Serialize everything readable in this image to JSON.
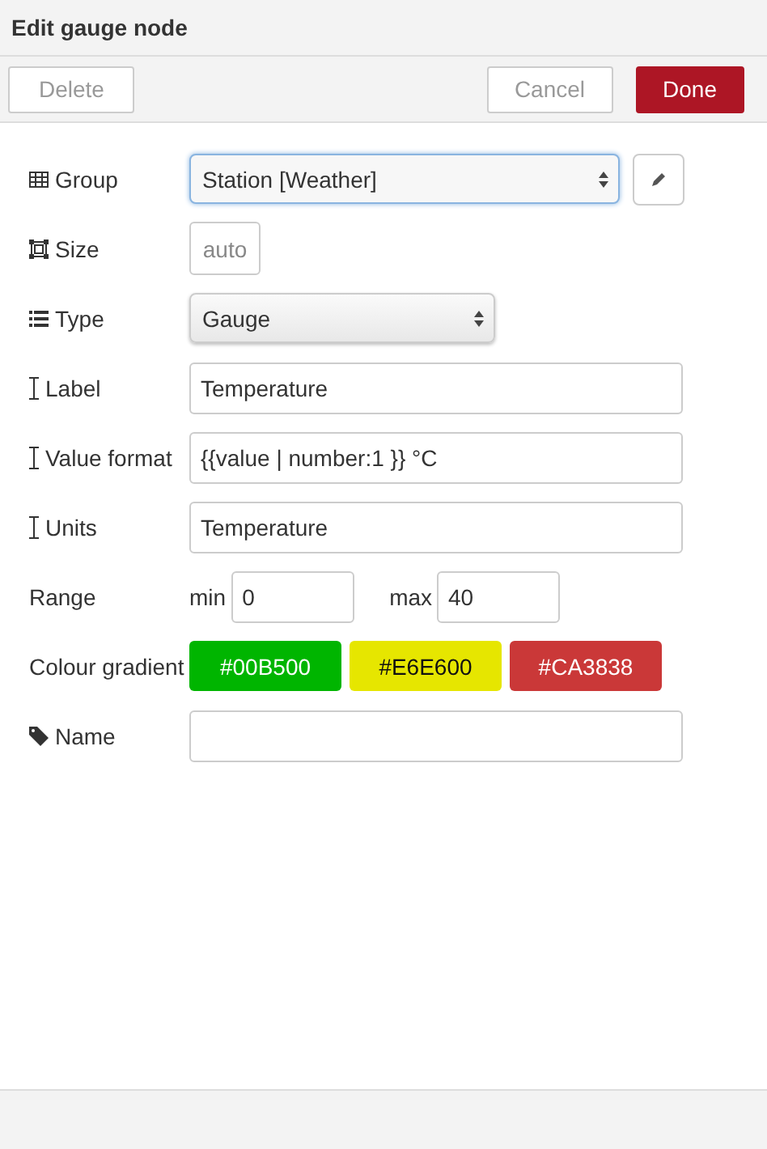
{
  "title": "Edit gauge node",
  "toolbar": {
    "delete": "Delete",
    "cancel": "Cancel",
    "done": "Done"
  },
  "group": {
    "label": "Group",
    "value": "Station [Weather]"
  },
  "size": {
    "label": "Size",
    "value": "auto"
  },
  "type": {
    "label": "Type",
    "value": "Gauge"
  },
  "label_field": {
    "label": "Label",
    "value": "Temperature"
  },
  "value_format": {
    "label": "Value format",
    "value": "{{value | number:1 }} °C"
  },
  "units": {
    "label": "Units",
    "value": "Temperature"
  },
  "range": {
    "label": "Range",
    "min_label": "min",
    "min": "0",
    "max_label": "max",
    "max": "40"
  },
  "colour_gradient": {
    "label": "Colour gradient",
    "swatches": [
      {
        "text": "#00B500",
        "color": "#00b500"
      },
      {
        "text": "#E6E600",
        "color": "#e6e600"
      },
      {
        "text": "#CA3838",
        "color": "#ca3838"
      }
    ]
  },
  "name": {
    "label": "Name"
  }
}
